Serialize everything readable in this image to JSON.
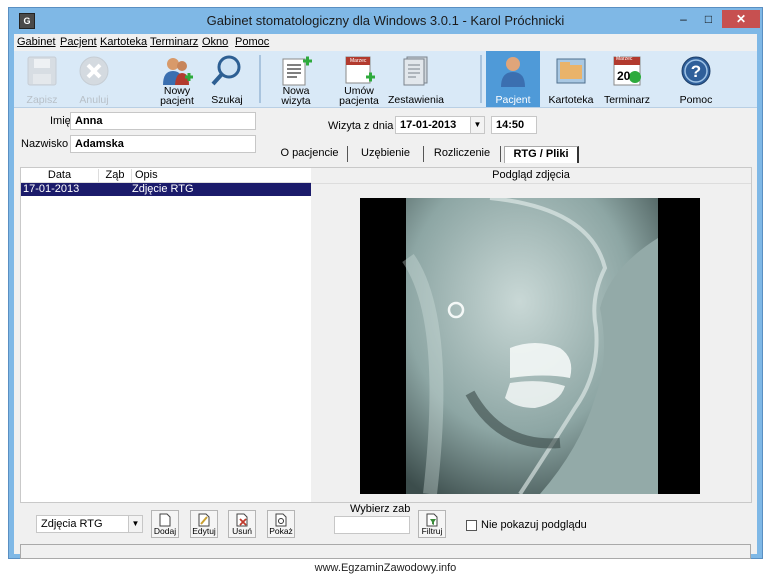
{
  "window": {
    "title": "Gabinet stomatologiczny dla Windows 3.0.1 - Karol Próchnicki",
    "app_icon": "G",
    "controls": {
      "minimize": "–",
      "maximize": "□",
      "close": "✕"
    }
  },
  "menu": {
    "items": [
      {
        "label": "Gabinet"
      },
      {
        "label": "Pacjent"
      },
      {
        "label": "Kartoteka"
      },
      {
        "label": "Terminarz"
      },
      {
        "label": "Okno"
      },
      {
        "label": "Pomoc"
      }
    ]
  },
  "toolbar": {
    "save": "Zapisz",
    "cancel": "Anuluj",
    "new_patient": [
      "Nowy",
      "pacjent"
    ],
    "search": "Szukaj",
    "new_visit": [
      "Nowa",
      "wizyta"
    ],
    "schedule": [
      "Umów",
      "pacjenta"
    ],
    "schedule_badge": "Marzec",
    "reports": "Zestawienia",
    "patient": "Pacjent",
    "records": "Kartoteka",
    "calendar": "Terminarz",
    "calendar_badge": "Marzec",
    "calendar_day": "20",
    "help": "Pomoc"
  },
  "patient": {
    "first_name_label": "Imię",
    "first_name": "Anna",
    "last_name_label": "Nazwisko",
    "last_name": "Adamska"
  },
  "visit": {
    "label": "Wizyta z dnia",
    "date": "17-01-2013",
    "time": "14:50"
  },
  "tabs": [
    {
      "label": "O pacjencie"
    },
    {
      "label": "Uzębienie"
    },
    {
      "label": "Rozliczenie"
    },
    {
      "label": "RTG / Pliki"
    }
  ],
  "list": {
    "columns": [
      "Data",
      "Ząb",
      "Opis"
    ],
    "rows": [
      {
        "date": "17-01-2013",
        "tooth": "",
        "desc": "Zdjęcie RTG"
      }
    ]
  },
  "preview": {
    "title": "Podgląd zdjęcia"
  },
  "bottom": {
    "type_select": "Zdjęcia RTG",
    "add": "Dodaj",
    "edit": "Edytuj",
    "delete": "Usuń",
    "show": "Pokaż",
    "choose_tooth_label": "Wybierz zab",
    "filter": "Filtruj",
    "no_preview": "Nie pokazuj podglądu"
  },
  "watermark": "www.EgzaminZawodowy.info"
}
